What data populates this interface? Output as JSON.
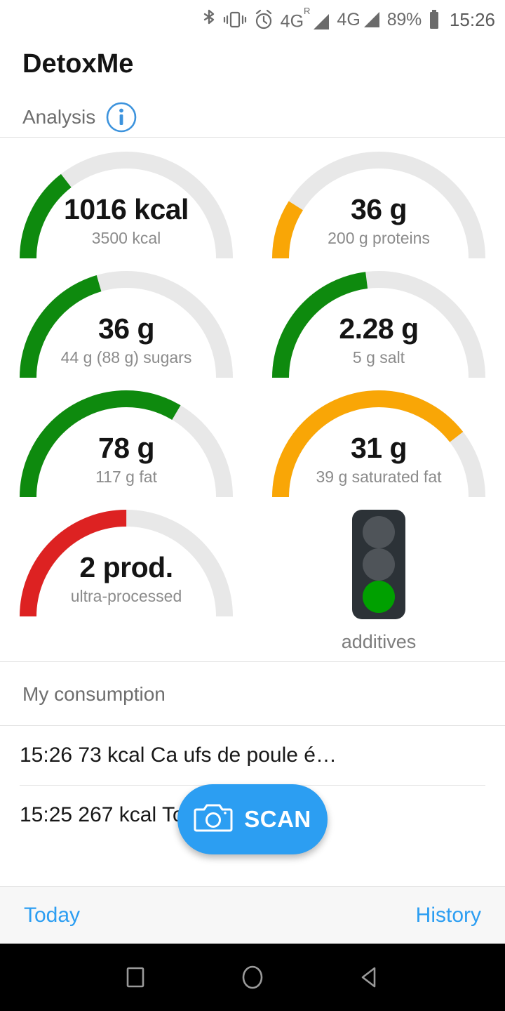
{
  "status_bar": {
    "icons": [
      "bluetooth-icon",
      "vibrate-icon",
      "alarm-icon",
      "signal-4g-roaming-icon",
      "signal-4g-icon",
      "battery-icon"
    ],
    "network_1": "4G",
    "network_1_sup": "R",
    "network_2": "4G",
    "battery_percent": "89%",
    "clock": "15:26"
  },
  "header": {
    "app_title": "DetoxMe",
    "subtitle": "Analysis",
    "info_icon": "info-icon"
  },
  "gauges": [
    {
      "value": "1016 kcal",
      "caption": "3500 kcal",
      "percent": 29,
      "color": "#0e8a0e"
    },
    {
      "value": "36 g",
      "caption": "200 g proteins",
      "percent": 18,
      "color": "#f9a606"
    },
    {
      "value": "36 g",
      "caption": "44 g (88 g) sugars",
      "percent": 41,
      "color": "#0e8a0e"
    },
    {
      "value": "2.28 g",
      "caption": "5 g salt",
      "percent": 46,
      "color": "#0e8a0e"
    },
    {
      "value": "78 g",
      "caption": "117 g fat",
      "percent": 67,
      "color": "#0e8a0e"
    },
    {
      "value": "31 g",
      "caption": "39 g saturated fat",
      "percent": 79,
      "color": "#f9a606"
    },
    {
      "value": "2 prod.",
      "caption": "ultra-processed",
      "percent": 50,
      "color": "#dd2222"
    }
  ],
  "traffic_light": {
    "caption": "additives",
    "lamp_top_color": "#4f5459",
    "lamp_middle_color": "#4f5459",
    "lamp_bottom_color": "#00a000",
    "body_color": "#2c3237",
    "icon": "traffic-light-icon"
  },
  "consumption": {
    "section_title": "My consumption",
    "items": [
      "15:26 73 kcal Ca                    ufs de poule é…",
      "15:25 267 kcal Toblerone"
    ]
  },
  "fab": {
    "label": "SCAN",
    "icon": "camera-icon",
    "color": "#2c9ef2"
  },
  "tabs": {
    "left_label": "Today",
    "right_label": "History",
    "color": "#2c9ef2"
  },
  "android_nav": {
    "recents": "square-icon",
    "home": "circle-icon",
    "back": "triangle-back-icon"
  },
  "chart_data": {
    "type": "gauge",
    "title": "Analysis",
    "gauges": [
      {
        "label": "calories",
        "value": 1016,
        "max": 3500,
        "unit": "kcal",
        "percent": 29,
        "color": "#0e8a0e"
      },
      {
        "label": "proteins",
        "value": 36,
        "max": 200,
        "unit": "g",
        "percent": 18,
        "color": "#f9a606"
      },
      {
        "label": "sugars",
        "value": 36,
        "max": 88,
        "unit": "g",
        "percent": 41,
        "color": "#0e8a0e"
      },
      {
        "label": "salt",
        "value": 2.28,
        "max": 5,
        "unit": "g",
        "percent": 46,
        "color": "#0e8a0e"
      },
      {
        "label": "fat",
        "value": 78,
        "max": 117,
        "unit": "g",
        "percent": 67,
        "color": "#0e8a0e"
      },
      {
        "label": "saturated fat",
        "value": 31,
        "max": 39,
        "unit": "g",
        "percent": 79,
        "color": "#f9a606"
      },
      {
        "label": "ultra-processed",
        "value": 2,
        "max": 4,
        "unit": "prod.",
        "percent": 50,
        "color": "#dd2222"
      }
    ],
    "track_color": "#e8e8e8",
    "sweep_degrees": 180
  }
}
